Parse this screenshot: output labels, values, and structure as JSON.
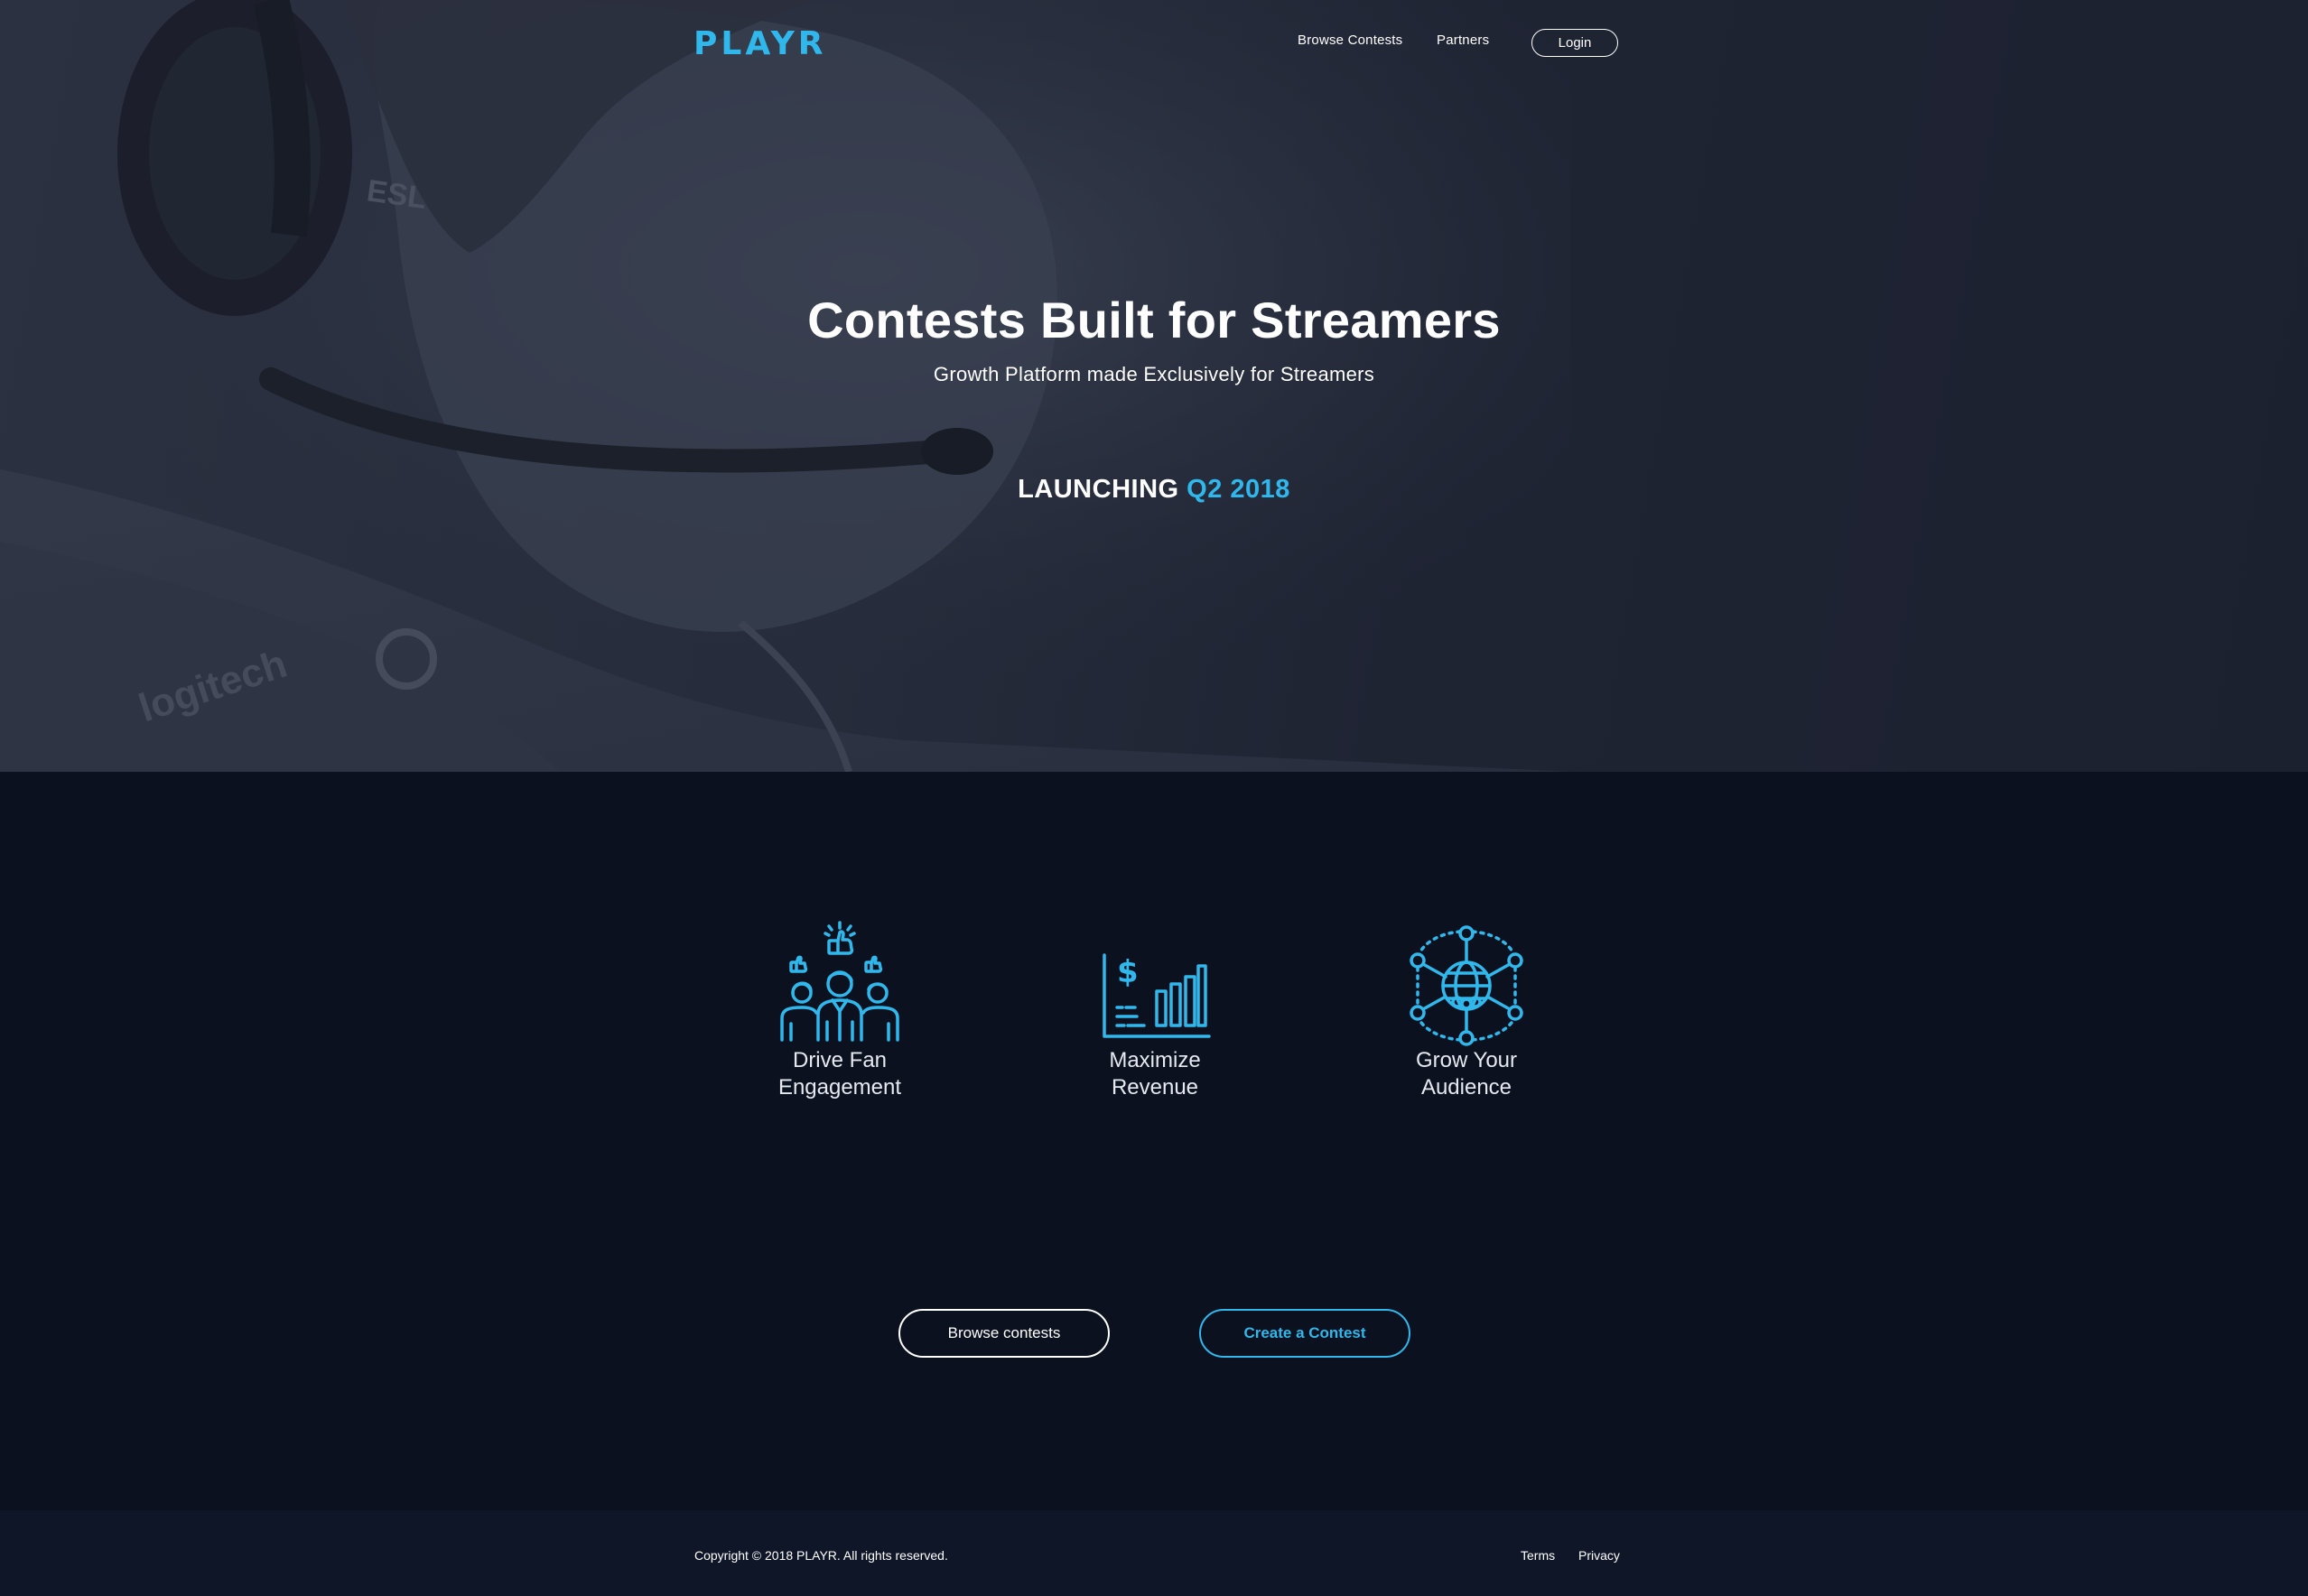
{
  "colors": {
    "accent": "#30b8ec",
    "hero_bg": "#262c3b",
    "body_bg": "#0b111f",
    "footer_bg": "#0f1628"
  },
  "nav": {
    "logo_text": "PLAYR",
    "links": [
      {
        "label": "Browse Contests"
      },
      {
        "label": "Partners"
      }
    ],
    "login_label": "Login"
  },
  "hero": {
    "title": "Contests Built for Streamers",
    "subtitle": "Growth Platform made Exclusively for Streamers",
    "launch_prefix": "LAUNCHING",
    "launch_date": "Q2 2018"
  },
  "features": [
    {
      "icon": "fans-engagement-icon",
      "line1": "Drive Fan",
      "line2": "Engagement"
    },
    {
      "icon": "revenue-chart-icon",
      "line1": "Maximize",
      "line2": "Revenue"
    },
    {
      "icon": "global-network-icon",
      "line1": "Grow Your",
      "line2": "Audience"
    }
  ],
  "cta": {
    "browse_label": "Browse contests",
    "create_label": "Create a Contest"
  },
  "footer": {
    "copyright": "Copyright © 2018 PLAYR. All rights reserved.",
    "links": [
      {
        "label": "Terms"
      },
      {
        "label": "Privacy"
      }
    ]
  }
}
